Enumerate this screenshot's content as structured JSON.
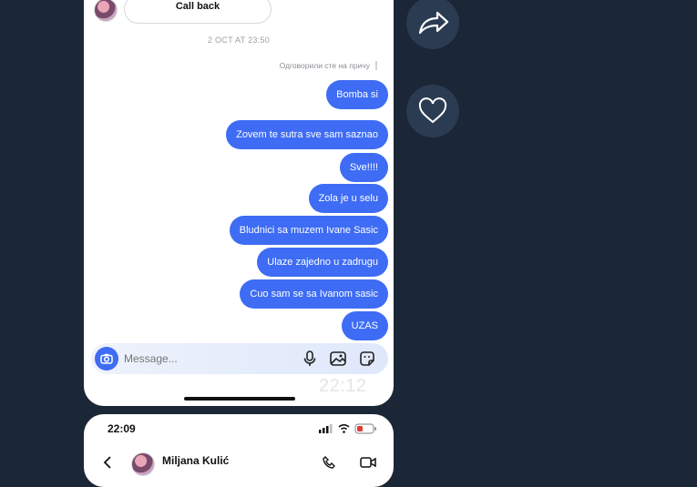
{
  "chat": {
    "call_back_label": "Call back",
    "timestamp": "2 OCT AT 23:50",
    "replied_label": "Одговорили сте на причу",
    "messages": [
      "Bomba si",
      "Zovem te sutra sve sam saznao",
      "Sve!!!!",
      "Zola je u selu",
      "Bludnici sa muzem Ivane Sasic",
      "Ulaze zajedno u zadrugu",
      "Cuo sam se sa Ivanom sasic",
      "UZAS"
    ],
    "accent_color": "#3e6cf4"
  },
  "composer": {
    "placeholder": "Message...",
    "icons": [
      "camera-icon",
      "microphone-icon",
      "gallery-icon",
      "sticker-icon"
    ]
  },
  "watermark": "22:12",
  "second_screen": {
    "status_time": "22:09",
    "contact_name": "Miljana Kulić"
  },
  "side_actions": {
    "icons": [
      "share-icon",
      "like-icon"
    ]
  }
}
